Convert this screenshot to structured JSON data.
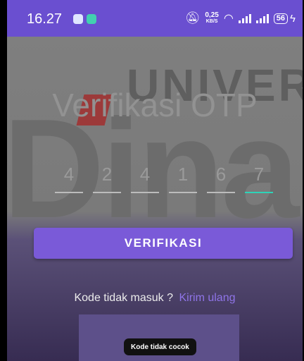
{
  "status_bar": {
    "time": "16.27",
    "net_speed_value": "0,25",
    "net_speed_unit": "KB/S",
    "battery": "56",
    "icons": [
      "gallery-notification-icon",
      "app-notification-icon",
      "mute-bell-icon",
      "wifi-icon",
      "signal-icon",
      "battery-icon",
      "charging-icon"
    ]
  },
  "watermark": {
    "line1": "UNIVERS",
    "line2": "Dinar"
  },
  "screen": {
    "title": "Verifikasi OTP",
    "otp_digits": [
      "4",
      "2",
      "4",
      "1",
      "6",
      "7"
    ],
    "verify_button": "VERIFIKASI",
    "resend_prompt": "Kode tidak masuk ?",
    "resend_link": "Kirim ulang",
    "toast": "Kode tidak cocok"
  },
  "colors": {
    "status_bar": "#6a4fd0",
    "button": "#7a5ad8",
    "link": "#8f74e8",
    "active_underline": "#2ed3b8"
  }
}
